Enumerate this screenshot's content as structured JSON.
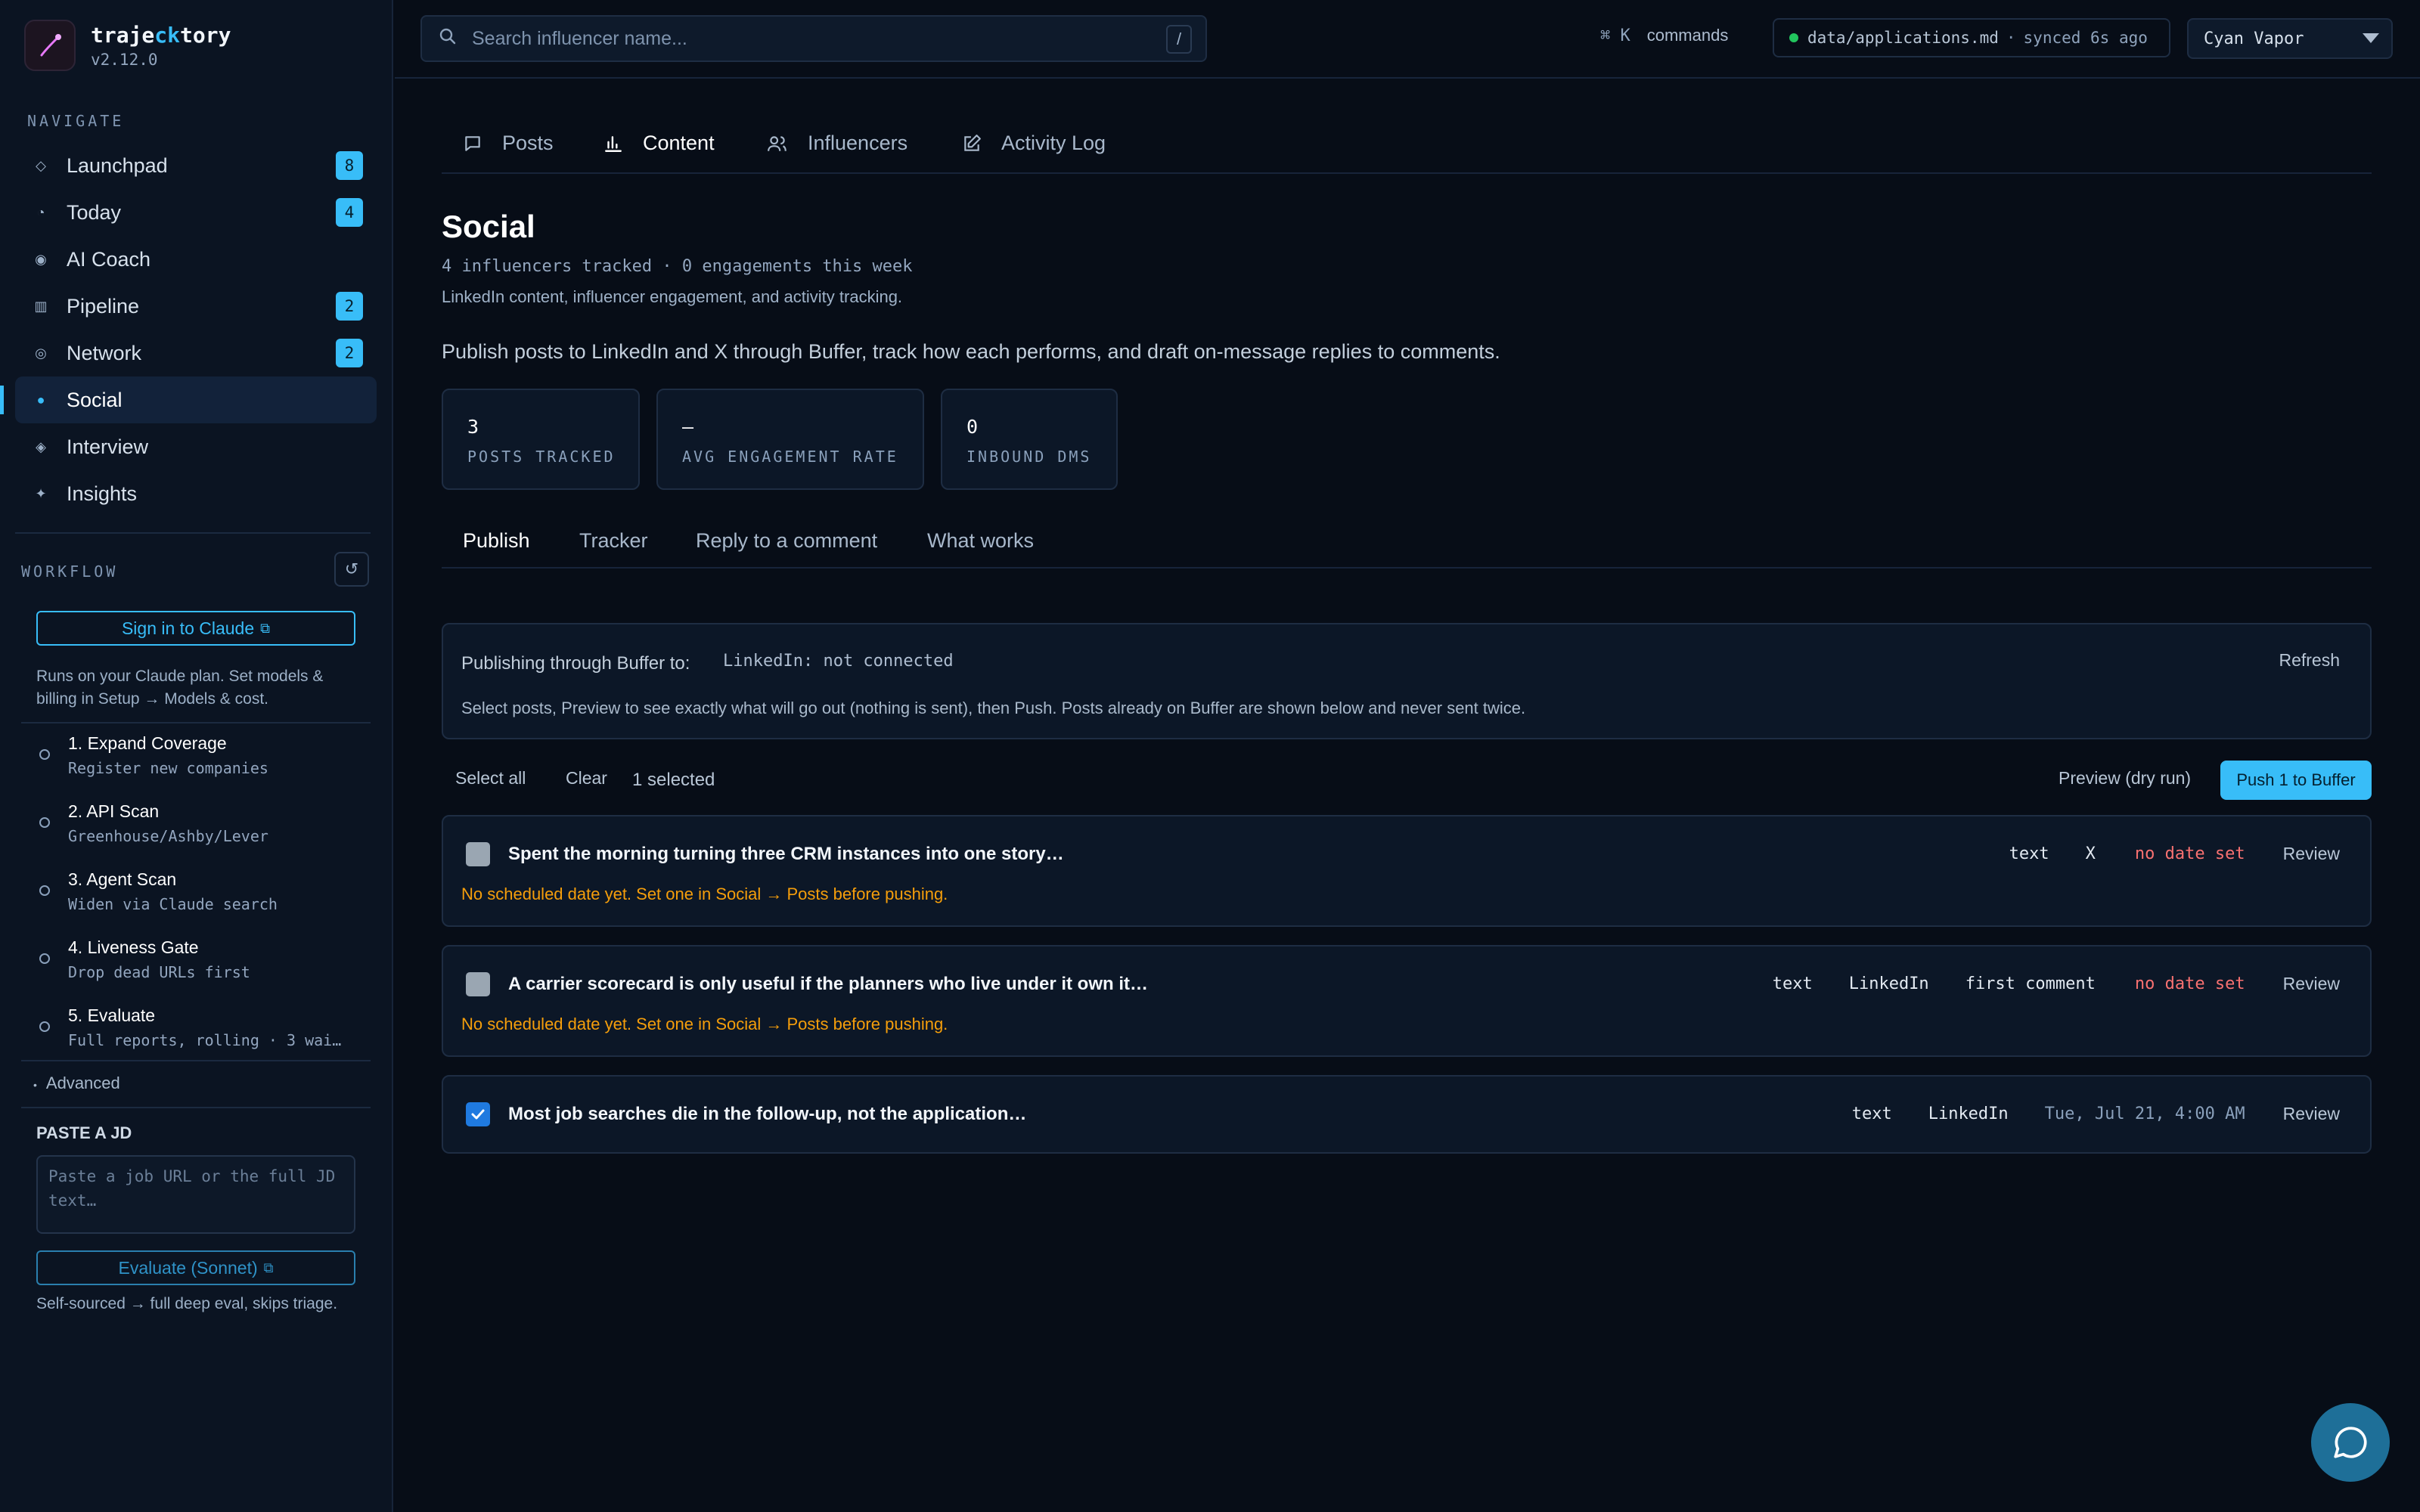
{
  "brand": {
    "name_part1": "traje",
    "name_accent": "ck",
    "name_part2": "tory",
    "version": "v2.12.0"
  },
  "sidebar": {
    "navigate_label": "NAVIGATE",
    "nav": [
      {
        "label": "Launchpad",
        "icon": "diamond-icon",
        "badge": "8"
      },
      {
        "label": "Today",
        "icon": "clock-icon",
        "badge": "4"
      },
      {
        "label": "AI Coach",
        "icon": "target-icon",
        "badge": ""
      },
      {
        "label": "Pipeline",
        "icon": "grid-icon",
        "badge": "2"
      },
      {
        "label": "Network",
        "icon": "ring-icon",
        "badge": "2"
      },
      {
        "label": "Social",
        "icon": "dot-icon",
        "badge": ""
      },
      {
        "label": "Interview",
        "icon": "diamond-dot-icon",
        "badge": ""
      },
      {
        "label": "Insights",
        "icon": "sparkle-icon",
        "badge": ""
      }
    ],
    "active_nav": "Social",
    "workflow_label": "WORKFLOW",
    "sign_in_label": "Sign in to Claude",
    "plan_note": "Runs on your Claude plan. Set models & billing in Setup → Models & cost.",
    "steps": [
      {
        "title": "1. Expand Coverage",
        "sub": "Register new companies"
      },
      {
        "title": "2. API Scan",
        "sub": "Greenhouse/Ashby/Lever"
      },
      {
        "title": "3. Agent Scan",
        "sub": "Widen via Claude search"
      },
      {
        "title": "4. Liveness Gate",
        "sub": "Drop dead URLs first"
      },
      {
        "title": "5. Evaluate",
        "sub": "Full reports, rolling · 3 wai…"
      }
    ],
    "advanced_label": "Advanced",
    "paste_title": "PASTE A JD",
    "paste_placeholder": "Paste a job URL or the full JD text…",
    "evaluate_label": "Evaluate (Sonnet)",
    "evaluate_note": "Self-sourced → full deep eval, skips triage."
  },
  "topbar": {
    "search_placeholder": "Search influencer name...",
    "search_shortcut": "/",
    "commands_key": "⌘ K",
    "commands_label": "commands",
    "sync_file": "data/applications.md",
    "sync_status": "synced 6s ago",
    "theme": "Cyan Vapor"
  },
  "tabs": [
    {
      "label": "Posts",
      "icon": "comment-icon"
    },
    {
      "label": "Content",
      "icon": "bar-chart-icon"
    },
    {
      "label": "Influencers",
      "icon": "users-icon"
    },
    {
      "label": "Activity Log",
      "icon": "edit-icon"
    }
  ],
  "active_tab": "Content",
  "page": {
    "title": "Social",
    "meta": "4 influencers tracked · 0 engagements this week",
    "tagline": "LinkedIn content, influencer engagement, and activity tracking.",
    "description": "Publish posts to LinkedIn and X through Buffer, track how each performs, and draft on-message replies to comments."
  },
  "stats": [
    {
      "value": "3",
      "label": "POSTS TRACKED"
    },
    {
      "value": "—",
      "label": "AVG ENGAGEMENT RATE"
    },
    {
      "value": "0",
      "label": "INBOUND DMS"
    }
  ],
  "subtabs": [
    "Publish",
    "Tracker",
    "Reply to a comment",
    "What works"
  ],
  "active_subtab": "Publish",
  "publish": {
    "label": "Publishing through Buffer to:",
    "target": "LinkedIn: not connected",
    "refresh": "Refresh",
    "help": "Select posts, Preview to see exactly what will go out (nothing is sent), then Push. Posts already on Buffer are shown below and never sent twice."
  },
  "actions": {
    "select_all": "Select all",
    "clear": "Clear",
    "selected_count": "1 selected",
    "preview": "Preview (dry run)",
    "push": "Push 1 to Buffer"
  },
  "posts": [
    {
      "title": "Spent the morning turning three CRM instances into one story…",
      "type": "text",
      "network": "X",
      "extra": "",
      "date": "no date set",
      "review": "Review",
      "warning": "No scheduled date yet. Set one in Social → Posts before pushing.",
      "checked": false
    },
    {
      "title": "A carrier scorecard is only useful if the planners who live under it own it…",
      "type": "text",
      "network": "LinkedIn",
      "extra": "first comment",
      "date": "no date set",
      "review": "Review",
      "warning": "No scheduled date yet. Set one in Social → Posts before pushing.",
      "checked": false
    },
    {
      "title": "Most job searches die in the follow-up, not the application…",
      "type": "text",
      "network": "LinkedIn",
      "extra": "",
      "date": "Tue, Jul 21, 4:00 AM",
      "review": "Review",
      "warning": "",
      "checked": true
    }
  ],
  "colors": {
    "accent": "#38bdf8",
    "background": "#070d17",
    "warning": "#f59e0b",
    "danger": "#f87171"
  }
}
